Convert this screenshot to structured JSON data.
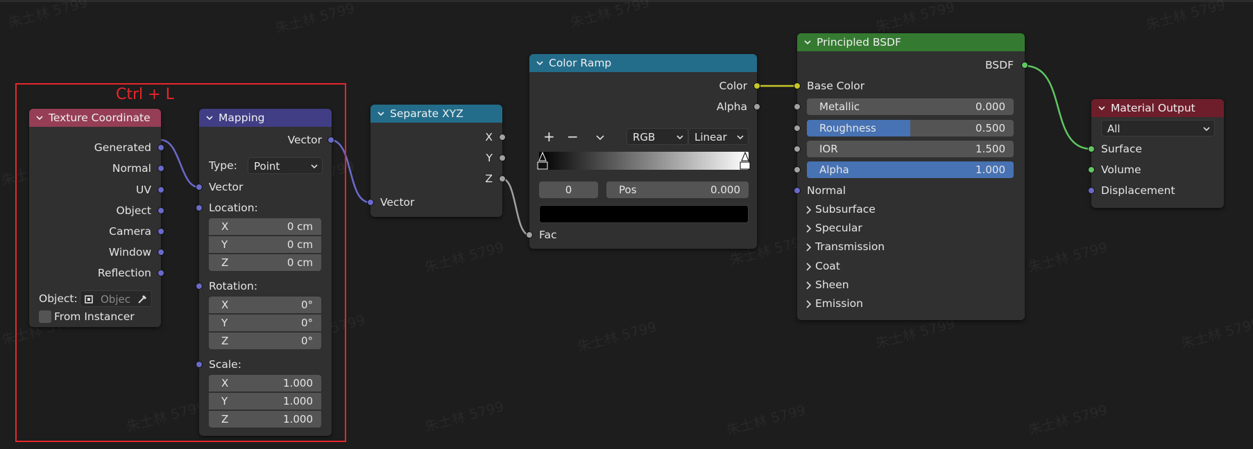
{
  "annotation": {
    "label": "Ctrl + L"
  },
  "watermark": "朱士林 5799",
  "colors": {
    "vector_socket": "#6a6acb",
    "color_socket": "#c7c729",
    "float_socket": "#a2a2a2",
    "shader_socket": "#62c662",
    "texture_header": "#963e56",
    "vector_header": "#413e86",
    "converter_header": "#236d8b",
    "shader_header": "#357a31",
    "output_header": "#6e1e2b",
    "annotation": "#e8262c",
    "slider_fill": "#4772b3"
  },
  "texture_coordinate": {
    "title": "Texture Coordinate",
    "outputs": [
      "Generated",
      "Normal",
      "UV",
      "Object",
      "Camera",
      "Window",
      "Reflection"
    ],
    "object_label": "Object:",
    "object_placeholder": "Objec",
    "from_instancer": "From Instancer"
  },
  "mapping": {
    "title": "Mapping",
    "output": "Vector",
    "type_label": "Type:",
    "type_value": "Point",
    "vector_input": "Vector",
    "location_label": "Location:",
    "location": [
      {
        "axis": "X",
        "value": "0 cm"
      },
      {
        "axis": "Y",
        "value": "0 cm"
      },
      {
        "axis": "Z",
        "value": "0 cm"
      }
    ],
    "rotation_label": "Rotation:",
    "rotation": [
      {
        "axis": "X",
        "value": "0°"
      },
      {
        "axis": "Y",
        "value": "0°"
      },
      {
        "axis": "Z",
        "value": "0°"
      }
    ],
    "scale_label": "Scale:",
    "scale": [
      {
        "axis": "X",
        "value": "1.000"
      },
      {
        "axis": "Y",
        "value": "1.000"
      },
      {
        "axis": "Z",
        "value": "1.000"
      }
    ]
  },
  "separate_xyz": {
    "title": "Separate XYZ",
    "outputs": [
      "X",
      "Y",
      "Z"
    ],
    "input": "Vector"
  },
  "color_ramp": {
    "title": "Color Ramp",
    "outputs": [
      "Color",
      "Alpha"
    ],
    "add": "+",
    "remove": "−",
    "color_mode": "RGB",
    "interpolation": "Linear",
    "stop_index": "0",
    "pos_label": "Pos",
    "pos_value": "0.000",
    "input": "Fac"
  },
  "principled_bsdf": {
    "title": "Principled BSDF",
    "output": "BSDF",
    "base_color": "Base Color",
    "metallic": {
      "label": "Metallic",
      "value": "0.000",
      "level": 0.0
    },
    "roughness": {
      "label": "Roughness",
      "value": "0.500",
      "level": 0.5
    },
    "ior": {
      "label": "IOR",
      "value": "1.500",
      "level": 0.0
    },
    "alpha": {
      "label": "Alpha",
      "value": "1.000",
      "level": 1.0
    },
    "normal": "Normal",
    "panels": [
      "Subsurface",
      "Specular",
      "Transmission",
      "Coat",
      "Sheen",
      "Emission"
    ]
  },
  "material_output": {
    "title": "Material Output",
    "target": "All",
    "inputs": [
      "Surface",
      "Volume",
      "Displacement"
    ]
  }
}
